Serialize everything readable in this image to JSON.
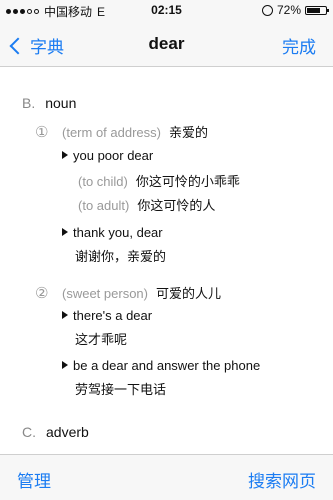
{
  "status_bar": {
    "carrier": "中国移动",
    "network": "E",
    "time": "02:15",
    "battery": "72%",
    "battery_level": 0.72
  },
  "nav": {
    "back_label": "字典",
    "title": "dear",
    "done_label": "完成"
  },
  "entries": {
    "noun": {
      "letter": "B.",
      "pos": "noun",
      "senses": [
        {
          "num": "①",
          "label": "(term of address)",
          "def": "亲爱的",
          "examples": [
            {
              "text": "you poor dear",
              "subsenses": [
                {
                  "label": "(to child)",
                  "def": "你这可怜的小乖乖"
                },
                {
                  "label": "(to adult)",
                  "def": "你这可怜的人"
                }
              ]
            },
            {
              "text": "thank you, dear",
              "translation": "谢谢你，亲爱的"
            }
          ]
        },
        {
          "num": "②",
          "label": "(sweet person)",
          "def": "可爱的人儿",
          "examples": [
            {
              "text": "there's a dear",
              "translation": "这才乖呢"
            },
            {
              "text": "be a dear and answer the phone",
              "translation": "劳驾接一下电话"
            }
          ]
        }
      ]
    },
    "adverb": {
      "letter": "C.",
      "pos": "adverb"
    }
  },
  "toolbar": {
    "manage_label": "管理",
    "search_web_label": "搜索网页"
  },
  "colors": {
    "accent": "#1b7cf2",
    "muted": "#999999"
  }
}
